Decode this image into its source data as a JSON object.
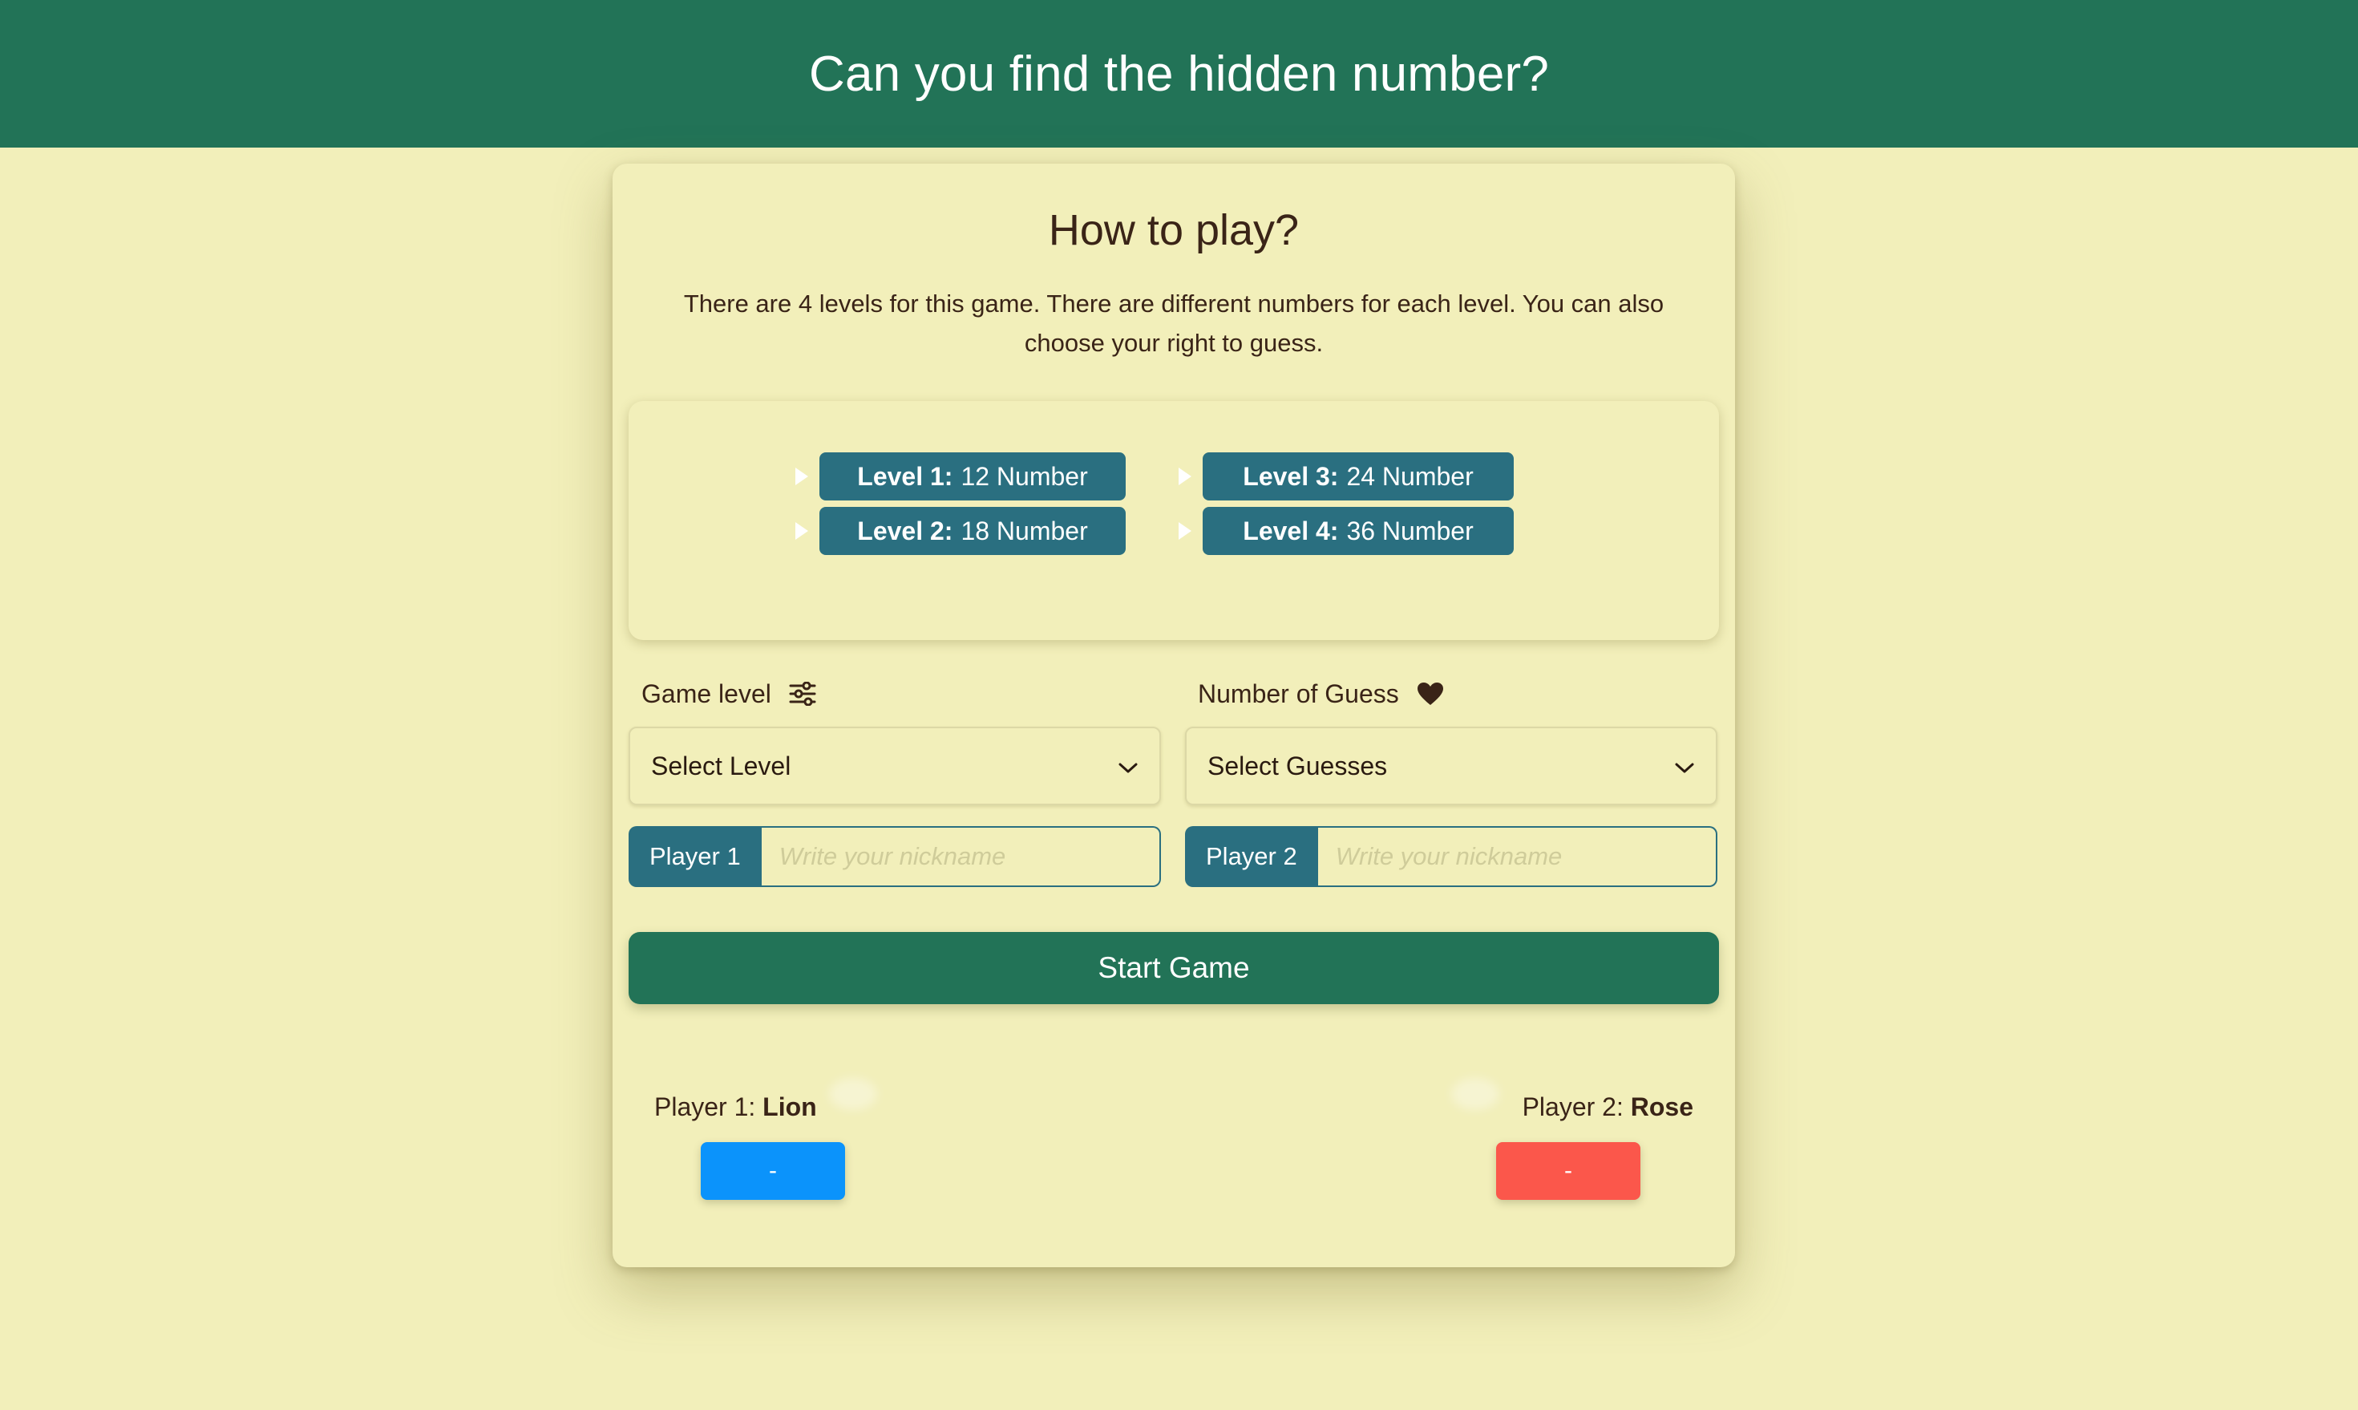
{
  "header": {
    "title": "Can you find the hidden number?"
  },
  "how_to_play": {
    "title": "How to play?",
    "text": "There are 4 levels for this game. There are different numbers for each level. You can also choose your right to guess."
  },
  "levels": [
    {
      "label": "Level 1:",
      "value": "12 Number"
    },
    {
      "label": "Level 2:",
      "value": "18 Number"
    },
    {
      "label": "Level 3:",
      "value": "24 Number"
    },
    {
      "label": "Level 4:",
      "value": "36 Number"
    }
  ],
  "form": {
    "game_level_label": "Game level",
    "game_level_icon": "sliders-icon",
    "guess_label": "Number of Guess",
    "guess_icon": "heart-icon",
    "level_select": "Select Level",
    "guess_select": "Select Guesses",
    "player1_tag": "Player 1",
    "player2_tag": "Player 2",
    "nickname_placeholder": "Write your nickname",
    "start_button": "Start Game"
  },
  "scoreboard": {
    "player1_prefix": "Player 1:",
    "player1_name": "Lion",
    "player1_score": "-",
    "player1_color": "#0b93fb",
    "player2_prefix": "Player 2:",
    "player2_name": "Rose",
    "player2_score": "-",
    "player2_color": "#fb574b"
  },
  "colors": {
    "header_bg": "#227357",
    "page_bg": "#f2efba",
    "pill_bg": "#2a6f80"
  }
}
